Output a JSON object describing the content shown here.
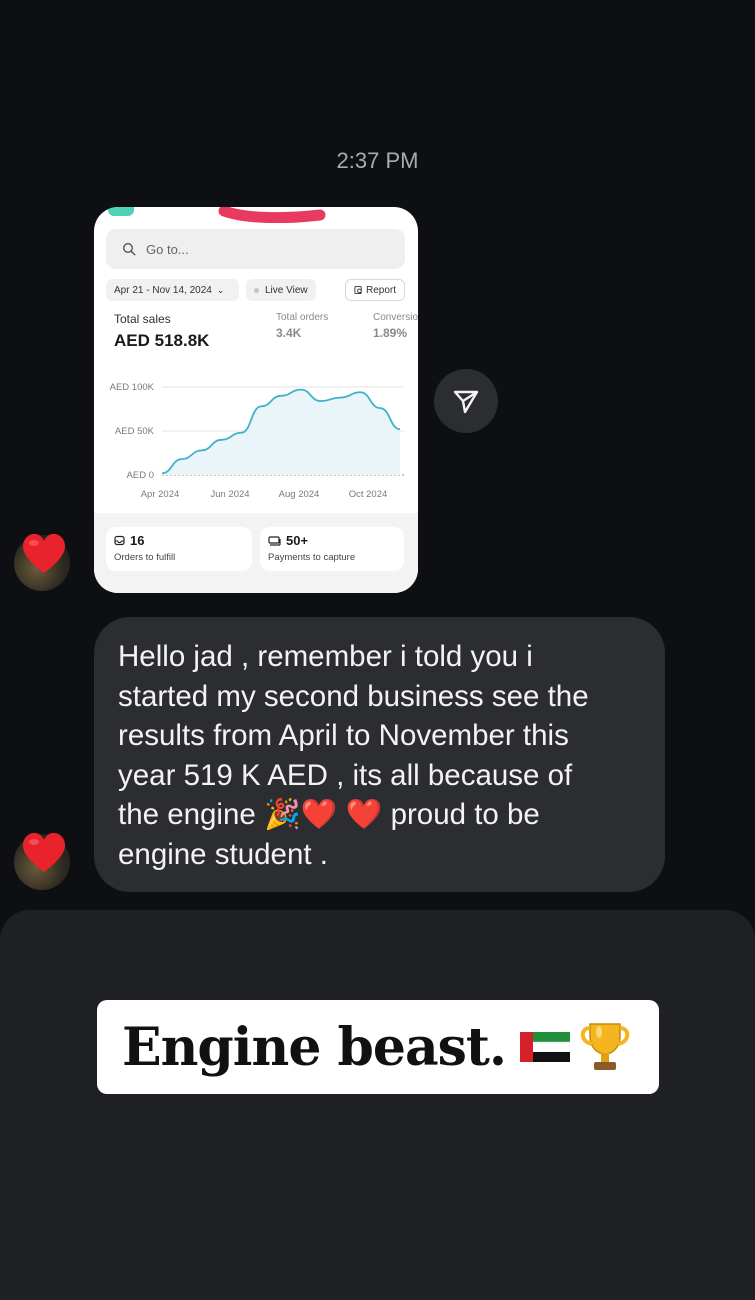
{
  "timestamp": "2:37 PM",
  "screenshot": {
    "search_placeholder": "Go to...",
    "date_range": "Apr 21 - Nov 14, 2024",
    "live_view": "Live View",
    "report": "Report",
    "total_sales_label": "Total sales",
    "total_sales_value": "AED 518.8K",
    "total_orders_label": "Total orders",
    "total_orders_value": "3.4K",
    "conversion_label": "Conversio",
    "conversion_value": "1.89%",
    "orders_count": "16",
    "orders_label": "Orders to fulfill",
    "payments_count": "50+",
    "payments_label": "Payments to capture"
  },
  "chart_data": {
    "type": "line",
    "y_tick_labels": [
      "AED 100K",
      "AED 50K",
      "AED 0"
    ],
    "x_tick_labels": [
      "Apr 2024",
      "Jun 2024",
      "Aug 2024",
      "Oct 2024"
    ],
    "ylim": [
      0,
      100000
    ],
    "line_color": "#3fb3c9",
    "series": [
      {
        "values": [
          2000,
          18000,
          28000,
          40000,
          48000,
          78000,
          90000,
          97000,
          84000,
          88000,
          94000,
          76000,
          52000
        ]
      }
    ]
  },
  "message": {
    "lines": [
      "Hello jad , remember i told you i",
      "started my second business see the",
      "results from April to November this",
      "year 519 K AED , its all because of",
      "the engine 🎉❤️ ❤️  proud to be",
      "engine student ."
    ]
  },
  "sticker": {
    "text": "Engine beast.",
    "emojis": [
      "uae-flag",
      "trophy"
    ]
  },
  "colors": {
    "background": "#0d0f12",
    "bubble": "#2b2d31",
    "panel": "#1e2023",
    "heart": "#e8232c"
  }
}
